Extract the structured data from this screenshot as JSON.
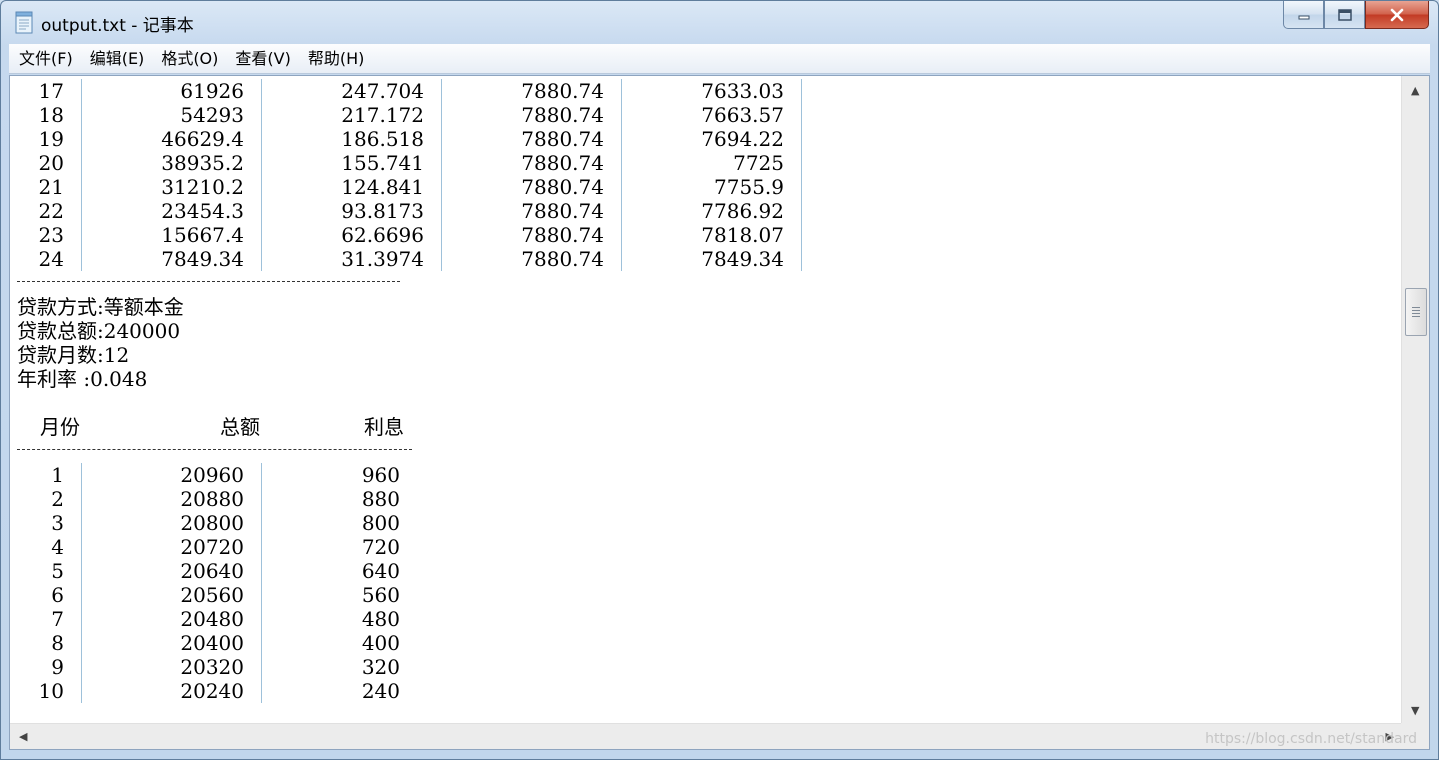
{
  "window": {
    "title": "output.txt - 记事本",
    "icon": "notepad-icon"
  },
  "menu": [
    "文件(F)",
    "编辑(E)",
    "格式(O)",
    "查看(V)",
    "帮助(H)"
  ],
  "table1": {
    "rows": [
      [
        "17",
        "61926",
        "247.704",
        "7880.74",
        "7633.03"
      ],
      [
        "18",
        "54293",
        "217.172",
        "7880.74",
        "7663.57"
      ],
      [
        "19",
        "46629.4",
        "186.518",
        "7880.74",
        "7694.22"
      ],
      [
        "20",
        "38935.2",
        "155.741",
        "7880.74",
        "7725"
      ],
      [
        "21",
        "31210.2",
        "124.841",
        "7880.74",
        "7755.9"
      ],
      [
        "22",
        "23454.3",
        "93.8173",
        "7880.74",
        "7786.92"
      ],
      [
        "23",
        "15667.4",
        "62.6696",
        "7880.74",
        "7818.07"
      ],
      [
        "24",
        "7849.34",
        "31.3974",
        "7880.74",
        "7849.34"
      ]
    ]
  },
  "loan_info": {
    "method": "贷款方式:等额本金",
    "total": "贷款总额:240000",
    "months": "贷款月数:12",
    "rate": "年利率  :0.048"
  },
  "table2": {
    "headers": [
      "月份",
      "总额",
      "利息"
    ],
    "rows": [
      [
        "1",
        "20960",
        "960"
      ],
      [
        "2",
        "20880",
        "880"
      ],
      [
        "3",
        "20800",
        "800"
      ],
      [
        "4",
        "20720",
        "720"
      ],
      [
        "5",
        "20640",
        "640"
      ],
      [
        "6",
        "20560",
        "560"
      ],
      [
        "7",
        "20480",
        "480"
      ],
      [
        "8",
        "20400",
        "400"
      ],
      [
        "9",
        "20320",
        "320"
      ],
      [
        "10",
        "20240",
        "240"
      ]
    ]
  },
  "watermark": "https://blog.csdn.net/standard"
}
